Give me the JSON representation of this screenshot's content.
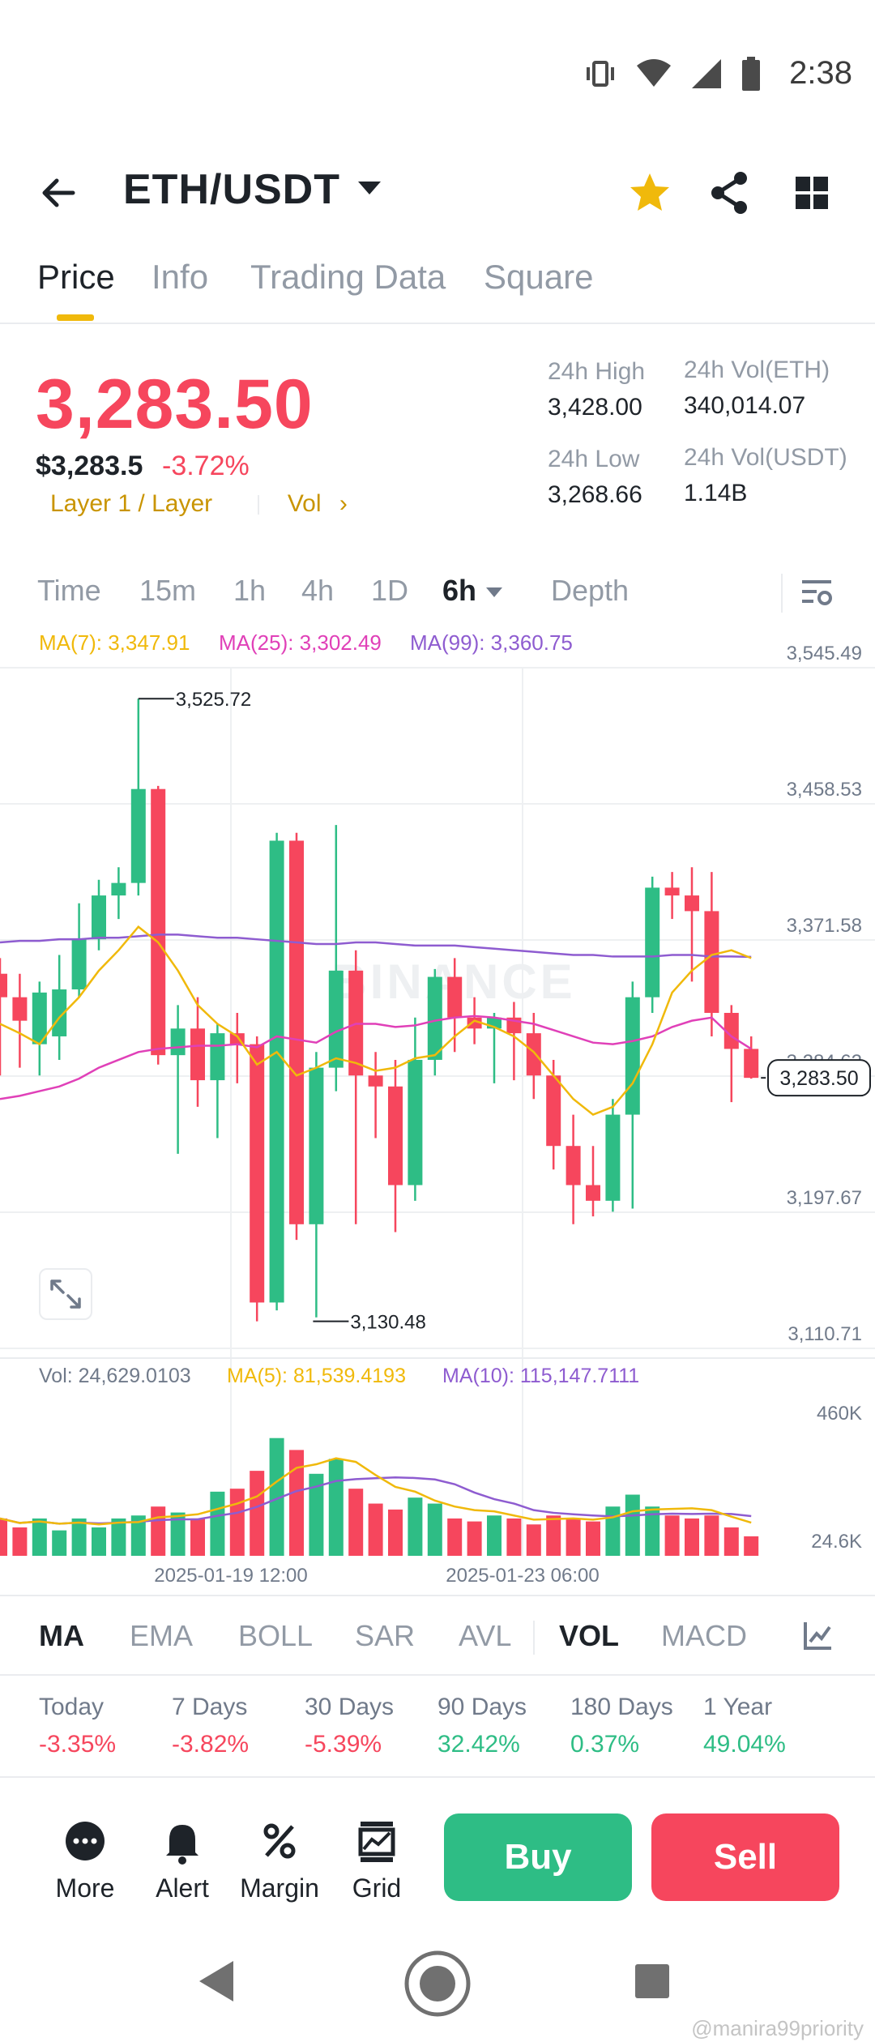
{
  "status_bar": {
    "time": "2:38"
  },
  "header": {
    "pair": "ETH/USDT"
  },
  "tabs": [
    "Price",
    "Info",
    "Trading Data",
    "Square"
  ],
  "price": {
    "last": "3,283.50",
    "fiat": "$3,283.5",
    "change": "-3.72%",
    "tag": "Layer 1 / Layer",
    "vol_link": "Vol"
  },
  "stats": {
    "high_label": "24h High",
    "high_value": "3,428.00",
    "low_label": "24h Low",
    "low_value": "3,268.66",
    "vol_eth_label": "24h Vol(ETH)",
    "vol_eth_value": "340,014.07",
    "vol_usdt_label": "24h Vol(USDT)",
    "vol_usdt_value": "1.14B"
  },
  "intervals": [
    "Time",
    "15m",
    "1h",
    "4h",
    "1D",
    "6h",
    "Depth"
  ],
  "chart": {
    "ma7": "MA(7): 3,347.91",
    "ma25": "MA(25): 3,302.49",
    "ma99": "MA(99): 3,360.75",
    "price_ticks": [
      "3,545.49",
      "3,458.53",
      "3,371.58",
      "3,284.62",
      "3,197.67",
      "3,110.71"
    ],
    "high_marker": "3,525.72",
    "low_marker": "3,130.48",
    "current_price": "3,283.50",
    "watermark": "BINANCE",
    "vol": "Vol: 24,629.0103",
    "vol_ma5": "MA(5): 81,539.4193",
    "vol_ma10": "MA(10): 115,147.7111",
    "vol_ticks": [
      "460K",
      "24.6K"
    ],
    "dates": [
      "2025-01-19 12:00",
      "2025-01-23 06:00"
    ],
    "colors": {
      "up": "#2ebd85",
      "down": "#f6465d",
      "ma7": "#f0b90b",
      "ma25": "#e040b8",
      "ma99": "#8e5cd0"
    }
  },
  "chart_data": {
    "type": "candlestick",
    "ylim": [
      3110.71,
      3545.49
    ],
    "candles": [
      {
        "o": 3350,
        "h": 3360,
        "l": 3285,
        "c": 3335
      },
      {
        "o": 3335,
        "h": 3350,
        "l": 3290,
        "c": 3320
      },
      {
        "o": 3305,
        "h": 3345,
        "l": 3285,
        "c": 3338
      },
      {
        "o": 3310,
        "h": 3362,
        "l": 3295,
        "c": 3340
      },
      {
        "o": 3340,
        "h": 3395,
        "l": 3335,
        "c": 3372
      },
      {
        "o": 3372,
        "h": 3410,
        "l": 3365,
        "c": 3400
      },
      {
        "o": 3400,
        "h": 3418,
        "l": 3385,
        "c": 3408
      },
      {
        "o": 3408,
        "h": 3525.72,
        "l": 3400,
        "c": 3468
      },
      {
        "o": 3468,
        "h": 3470,
        "l": 3292,
        "c": 3298
      },
      {
        "o": 3298,
        "h": 3330,
        "l": 3235,
        "c": 3315
      },
      {
        "o": 3315,
        "h": 3335,
        "l": 3265,
        "c": 3282
      },
      {
        "o": 3282,
        "h": 3318,
        "l": 3245,
        "c": 3312
      },
      {
        "o": 3312,
        "h": 3325,
        "l": 3280,
        "c": 3305
      },
      {
        "o": 3305,
        "h": 3310,
        "l": 3128,
        "c": 3140
      },
      {
        "o": 3140,
        "h": 3440,
        "l": 3135,
        "c": 3435
      },
      {
        "o": 3435,
        "h": 3440,
        "l": 3180,
        "c": 3190
      },
      {
        "o": 3190,
        "h": 3300,
        "l": 3130.48,
        "c": 3290
      },
      {
        "o": 3290,
        "h": 3445,
        "l": 3275,
        "c": 3352
      },
      {
        "o": 3352,
        "h": 3365,
        "l": 3190,
        "c": 3285
      },
      {
        "o": 3285,
        "h": 3300,
        "l": 3245,
        "c": 3278
      },
      {
        "o": 3278,
        "h": 3295,
        "l": 3185,
        "c": 3215
      },
      {
        "o": 3215,
        "h": 3322,
        "l": 3205,
        "c": 3295
      },
      {
        "o": 3295,
        "h": 3353,
        "l": 3285,
        "c": 3348
      },
      {
        "o": 3348,
        "h": 3360,
        "l": 3300,
        "c": 3322
      },
      {
        "o": 3322,
        "h": 3335,
        "l": 3305,
        "c": 3315
      },
      {
        "o": 3315,
        "h": 3325,
        "l": 3280,
        "c": 3322
      },
      {
        "o": 3322,
        "h": 3332,
        "l": 3282,
        "c": 3312
      },
      {
        "o": 3312,
        "h": 3325,
        "l": 3270,
        "c": 3285
      },
      {
        "o": 3285,
        "h": 3295,
        "l": 3225,
        "c": 3240
      },
      {
        "o": 3240,
        "h": 3260,
        "l": 3190,
        "c": 3215
      },
      {
        "o": 3215,
        "h": 3240,
        "l": 3195,
        "c": 3205
      },
      {
        "o": 3205,
        "h": 3270,
        "l": 3198,
        "c": 3260
      },
      {
        "o": 3260,
        "h": 3345,
        "l": 3200,
        "c": 3335
      },
      {
        "o": 3335,
        "h": 3412,
        "l": 3325,
        "c": 3405
      },
      {
        "o": 3405,
        "h": 3415,
        "l": 3385,
        "c": 3400
      },
      {
        "o": 3400,
        "h": 3418,
        "l": 3345,
        "c": 3390
      },
      {
        "o": 3390,
        "h": 3415,
        "l": 3310,
        "c": 3325
      },
      {
        "o": 3325,
        "h": 3330,
        "l": 3268,
        "c": 3302
      },
      {
        "o": 3302,
        "h": 3310,
        "l": 3283,
        "c": 3283.5
      }
    ],
    "ma7": [
      3318,
      3312,
      3305,
      3322,
      3335,
      3352,
      3365,
      3380,
      3370,
      3352,
      3330,
      3318,
      3310,
      3292,
      3300,
      3285,
      3290,
      3296,
      3293,
      3288,
      3290,
      3296,
      3298,
      3310,
      3320,
      3316,
      3310,
      3300,
      3285,
      3270,
      3260,
      3265,
      3280,
      3305,
      3338,
      3352,
      3362,
      3365,
      3360
    ],
    "ma25": [
      3270,
      3272,
      3275,
      3278,
      3283,
      3290,
      3295,
      3300,
      3302,
      3303,
      3304,
      3304,
      3305,
      3303,
      3310,
      3308,
      3306,
      3313,
      3318,
      3318,
      3316,
      3317,
      3320,
      3322,
      3323,
      3322,
      3320,
      3318,
      3314,
      3310,
      3306,
      3305,
      3307,
      3310,
      3316,
      3320,
      3322,
      3310,
      3302
    ],
    "ma99": [
      3370,
      3371,
      3371,
      3372,
      3372,
      3373,
      3373,
      3374,
      3375,
      3375,
      3374,
      3373,
      3373,
      3372,
      3371,
      3370,
      3369,
      3369,
      3370,
      3370,
      3369,
      3368,
      3368,
      3368,
      3367,
      3366,
      3365,
      3364,
      3363,
      3362,
      3362,
      3361,
      3361,
      3361,
      3362,
      3362,
      3361,
      3361,
      3360.75
    ],
    "volume": [
      150,
      120,
      150,
      110,
      150,
      120,
      150,
      160,
      190,
      170,
      150,
      240,
      250,
      310,
      420,
      380,
      300,
      350,
      250,
      200,
      180,
      220,
      200,
      150,
      140,
      160,
      150,
      130,
      160,
      150,
      140,
      190,
      230,
      190,
      160,
      150,
      160,
      120,
      90
    ],
    "volume_ylim": [
      24.6,
      460
    ]
  },
  "indicators": [
    "MA",
    "EMA",
    "BOLL",
    "SAR",
    "AVL",
    "VOL",
    "MACD"
  ],
  "performance": [
    {
      "label": "Today",
      "value": "-3.35%",
      "color": "#f6465d"
    },
    {
      "label": "7 Days",
      "value": "-3.82%",
      "color": "#f6465d"
    },
    {
      "label": "30 Days",
      "value": "-5.39%",
      "color": "#f6465d"
    },
    {
      "label": "90 Days",
      "value": "32.42%",
      "color": "#2ebd85"
    },
    {
      "label": "180 Days",
      "value": "0.37%",
      "color": "#2ebd85"
    },
    {
      "label": "1 Year",
      "value": "49.04%",
      "color": "#2ebd85"
    }
  ],
  "actions": [
    "More",
    "Alert",
    "Margin",
    "Grid"
  ],
  "buttons": {
    "buy": "Buy",
    "sell": "Sell"
  },
  "watermark_text": "@manira99priority"
}
